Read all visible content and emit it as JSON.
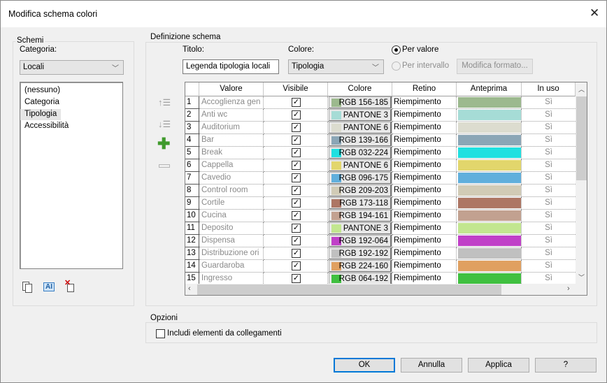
{
  "window": {
    "title": "Modifica schema colori"
  },
  "schemi": {
    "group_label": "Schemi",
    "categoria_label": "Categoria:",
    "categoria_value": "Locali",
    "items": [
      "(nessuno)",
      "Categoria",
      "Tipologia",
      "Accessibilità"
    ],
    "selected": "Tipologia",
    "icons": [
      "duplicate-icon",
      "rename-icon",
      "delete-icon"
    ]
  },
  "definizione": {
    "group_label": "Definizione schema",
    "titolo_label": "Titolo:",
    "titolo_value": "Legenda tipologia locali",
    "colore_label": "Colore:",
    "colore_value": "Tipologia",
    "radio_per_valore": "Per valore",
    "radio_per_intervallo": "Per intervallo",
    "radio_selected": "Per valore",
    "modifica_formato": "Modifica formato...",
    "side_icons": [
      "move-up-icon",
      "move-down-icon",
      "add-icon",
      "remove-icon"
    ]
  },
  "table": {
    "headers": [
      "",
      "Valore",
      "Visibile",
      "Colore",
      "Retino",
      "Anteprima",
      "In uso"
    ],
    "rows": [
      {
        "n": "1",
        "valore": "Accoglienza gen",
        "visibile": true,
        "colore": "RGB 156-185",
        "hex": "#9cb98e",
        "retino": "Riempimento",
        "in_uso": "Sì"
      },
      {
        "n": "2",
        "valore": "Anti wc",
        "visibile": true,
        "colore": "PANTONE 3",
        "hex": "#a6dcd6",
        "retino": "Riempimento",
        "in_uso": "Sì"
      },
      {
        "n": "3",
        "valore": "Auditorium",
        "visibile": true,
        "colore": "PANTONE 6",
        "hex": "#dcdccf",
        "retino": "Riempimento",
        "in_uso": "Sì"
      },
      {
        "n": "4",
        "valore": "Bar",
        "visibile": true,
        "colore": "RGB 139-166",
        "hex": "#8ba6b6",
        "retino": "Riempimento",
        "in_uso": "Sì"
      },
      {
        "n": "5",
        "valore": "Break",
        "visibile": true,
        "colore": "RGB 032-224",
        "hex": "#20e0e0",
        "retino": "Riempimento",
        "in_uso": "Sì"
      },
      {
        "n": "6",
        "valore": "Cappella",
        "visibile": true,
        "colore": "PANTONE 6",
        "hex": "#e2d66c",
        "retino": "Riempimento",
        "in_uso": "Sì"
      },
      {
        "n": "7",
        "valore": "Cavedio",
        "visibile": true,
        "colore": "RGB 096-175",
        "hex": "#60afdc",
        "retino": "Riempimento",
        "in_uso": "Sì"
      },
      {
        "n": "8",
        "valore": "Control room",
        "visibile": true,
        "colore": "RGB 209-203",
        "hex": "#d1cbb6",
        "retino": "Riempimento",
        "in_uso": "Sì"
      },
      {
        "n": "9",
        "valore": "Cortile",
        "visibile": true,
        "colore": "RGB 173-118",
        "hex": "#ad7664",
        "retino": "Riempimento",
        "in_uso": "Sì"
      },
      {
        "n": "10",
        "valore": "Cucina",
        "visibile": true,
        "colore": "RGB 194-161",
        "hex": "#c2a190",
        "retino": "Riempimento",
        "in_uso": "Sì"
      },
      {
        "n": "11",
        "valore": "Deposito",
        "visibile": true,
        "colore": "PANTONE 3",
        "hex": "#c2e690",
        "retino": "Riempimento",
        "in_uso": "Sì"
      },
      {
        "n": "12",
        "valore": "Dispensa",
        "visibile": true,
        "colore": "RGB 192-064",
        "hex": "#c040c8",
        "retino": "Riempimento",
        "in_uso": "Sì"
      },
      {
        "n": "13",
        "valore": "Distribuzione ori",
        "visibile": true,
        "colore": "RGB 192-192",
        "hex": "#c0c0c0",
        "retino": "Riempimento",
        "in_uso": "Sì"
      },
      {
        "n": "14",
        "valore": "Guardaroba",
        "visibile": true,
        "colore": "RGB 224-160",
        "hex": "#e0a060",
        "retino": "Riempimento",
        "in_uso": "Sì"
      },
      {
        "n": "15",
        "valore": "Ingresso",
        "visibile": true,
        "colore": "RGB 064-192",
        "hex": "#40c040",
        "retino": "Riempimento",
        "in_uso": "Sì"
      }
    ]
  },
  "opzioni": {
    "group_label": "Opzioni",
    "includi_label": "Includi elementi da collegamenti",
    "includi_checked": false
  },
  "buttons": {
    "ok": "OK",
    "annulla": "Annulla",
    "applica": "Applica",
    "help": "?"
  }
}
